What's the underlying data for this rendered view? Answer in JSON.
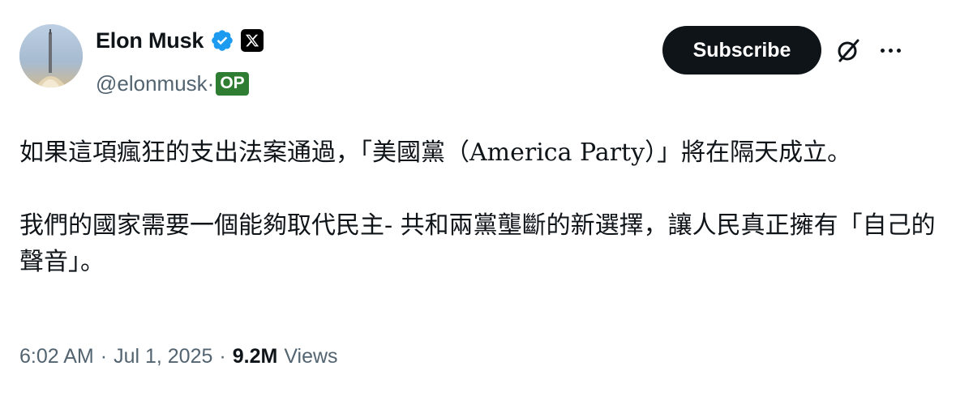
{
  "author": {
    "display_name": "Elon Musk",
    "handle": "@elonmusk·",
    "op_badge": "OP",
    "verified_color": "#1d9bf0",
    "affiliation_icon": "x-logo-icon"
  },
  "actions": {
    "subscribe_label": "Subscribe",
    "grok_icon": "grok-icon",
    "more_icon": "more-icon"
  },
  "tweet": {
    "paragraphs": [
      "如果這項瘋狂的支出法案通過，「美國黨（America Party）」將在隔天成立。",
      "我們的國家需要一個能夠取代民主- 共和兩黨壟斷的新選擇，讓人民真正擁有「自己的聲音」。"
    ]
  },
  "meta": {
    "time": "6:02 AM",
    "separator": "·",
    "date": "Jul 1, 2025",
    "views_count": "9.2M",
    "views_label": "Views"
  }
}
